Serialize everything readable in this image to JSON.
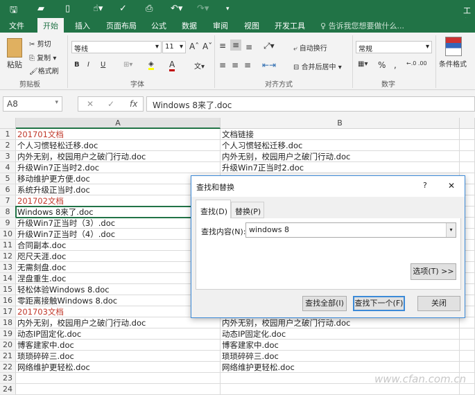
{
  "title_partial": "工作",
  "qat": {
    "icons": [
      "save-icon",
      "open-icon",
      "new-icon",
      "touch-mode-icon",
      "spell-icon",
      "print-preview-icon",
      "undo-icon",
      "redo-icon",
      "customize-icon"
    ]
  },
  "tabs": [
    "文件",
    "开始",
    "插入",
    "页面布局",
    "公式",
    "数据",
    "审阅",
    "视图",
    "开发工具"
  ],
  "active_tab": "开始",
  "tell_me": "告诉我您想要做什么...",
  "ribbon": {
    "clipboard": {
      "paste": "粘贴",
      "cut": "剪切",
      "copy": "复制",
      "format_painter": "格式刷",
      "label": "剪贴板"
    },
    "font": {
      "name": "等线",
      "size": "11",
      "bold": "B",
      "italic": "I",
      "underline": "U",
      "label": "字体",
      "accent_fill": "#ffff00",
      "accent_font": "#c00000"
    },
    "alignment": {
      "wrap": "自动换行",
      "merge": "合并后居中",
      "label": "对齐方式"
    },
    "number": {
      "format": "常规",
      "percent": "%",
      "comma": ",",
      "label": "数字"
    },
    "styles": {
      "conditional": "条件格式"
    }
  },
  "formula_bar": {
    "name_box": "A8",
    "fx": "fx",
    "value": "Windows 8来了.doc"
  },
  "columns": [
    "A",
    "B"
  ],
  "rows": [
    {
      "n": "1",
      "a": "201701文档",
      "b": "文档链接",
      "red": true
    },
    {
      "n": "2",
      "a": "个人习惯轻松迁移.doc",
      "b": "个人习惯轻松迁移.doc"
    },
    {
      "n": "3",
      "a": "内外无别，校园用户之破门行动.doc",
      "b": "内外无别，校园用户之破门行动.doc"
    },
    {
      "n": "4",
      "a": "升级Win7正当时2.doc",
      "b": "升级Win7正当时2.doc"
    },
    {
      "n": "5",
      "a": "移动维护更方便.doc",
      "b": ""
    },
    {
      "n": "6",
      "a": "系统升级正当时.doc",
      "b": ""
    },
    {
      "n": "7",
      "a": "201702文档",
      "b": "",
      "red": true
    },
    {
      "n": "8",
      "a": "Windows 8来了.doc",
      "b": "",
      "selected": true
    },
    {
      "n": "9",
      "a": "升级Win7正当时（3）.doc",
      "b": ""
    },
    {
      "n": "10",
      "a": "升级Win7正当时（4）.doc",
      "b": ""
    },
    {
      "n": "11",
      "a": "合同副本.doc",
      "b": ""
    },
    {
      "n": "12",
      "a": "咫尺天涯.doc",
      "b": ""
    },
    {
      "n": "13",
      "a": "无需刻盘.doc",
      "b": ""
    },
    {
      "n": "14",
      "a": "涅盘重生.doc",
      "b": ""
    },
    {
      "n": "15",
      "a": "轻松体验Windows 8.doc",
      "b": ""
    },
    {
      "n": "16",
      "a": "零距离接触Windows 8.doc",
      "b": ""
    },
    {
      "n": "17",
      "a": "201703文档",
      "b": "",
      "red": true
    },
    {
      "n": "18",
      "a": "内外无别，校园用户之破门行动.doc",
      "b": "内外无别，校园用户之破门行动.doc"
    },
    {
      "n": "19",
      "a": "动态IP固定化.doc",
      "b": "动态IP固定化.doc"
    },
    {
      "n": "20",
      "a": "博客建家中.doc",
      "b": "博客建家中.doc"
    },
    {
      "n": "21",
      "a": "琐琐碎碎三.doc",
      "b": "琐琐碎碎三.doc"
    },
    {
      "n": "22",
      "a": "网络维护更轻松.doc",
      "b": "网络维护更轻松.doc"
    },
    {
      "n": "23",
      "a": "",
      "b": ""
    },
    {
      "n": "24",
      "a": "",
      "b": ""
    }
  ],
  "dialog": {
    "title": "查找和替换",
    "help": "?",
    "close": "✕",
    "tabs": [
      "查找(D)",
      "替换(P)"
    ],
    "find_label": "查找内容(N):",
    "find_value": "windows 8",
    "options": "选项(T) >>",
    "find_all": "查找全部(I)",
    "find_next": "查找下一个(F)",
    "close_btn": "关闭"
  },
  "watermark": "www.cfan.com.cn"
}
